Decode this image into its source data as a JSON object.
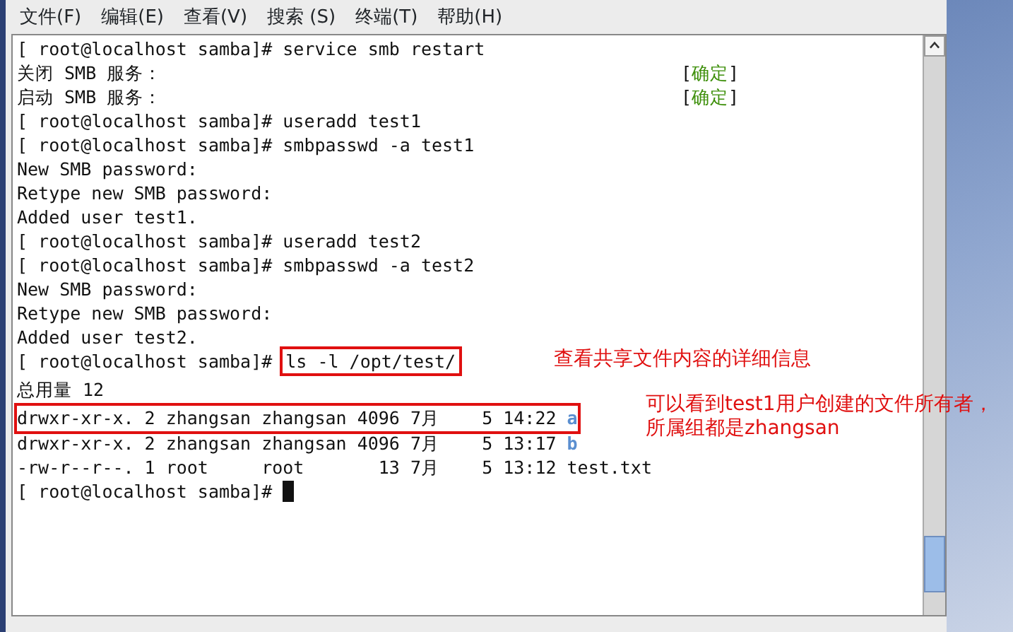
{
  "menu": [
    "文件(F)",
    "编辑(E)",
    "查看(V)",
    "搜索 (S)",
    "终端(T)",
    "帮助(H)"
  ],
  "terminal": {
    "lines": [
      {
        "segments": [
          {
            "text": "[ root@localhost samba]# service smb restart",
            "kind": "plain"
          }
        ]
      },
      {
        "segments": [
          {
            "text": "关闭 SMB 服务：",
            "kind": "plain"
          }
        ],
        "right": [
          {
            "text": "[",
            "kind": "plain"
          },
          {
            "text": "确定",
            "kind": "ok"
          },
          {
            "text": "]",
            "kind": "plain"
          }
        ]
      },
      {
        "segments": [
          {
            "text": "启动 SMB 服务：",
            "kind": "plain"
          }
        ],
        "right": [
          {
            "text": "[",
            "kind": "plain"
          },
          {
            "text": "确定",
            "kind": "ok"
          },
          {
            "text": "]",
            "kind": "plain"
          }
        ]
      },
      {
        "segments": [
          {
            "text": "[ root@localhost samba]# useradd test1",
            "kind": "plain"
          }
        ]
      },
      {
        "segments": [
          {
            "text": "[ root@localhost samba]# smbpasswd -a test1",
            "kind": "plain"
          }
        ]
      },
      {
        "segments": [
          {
            "text": "New SMB password:",
            "kind": "plain"
          }
        ]
      },
      {
        "segments": [
          {
            "text": "Retype new SMB password:",
            "kind": "plain"
          }
        ]
      },
      {
        "segments": [
          {
            "text": "Added user test1.",
            "kind": "plain"
          }
        ]
      },
      {
        "segments": [
          {
            "text": "[ root@localhost samba]# useradd test2",
            "kind": "plain"
          }
        ]
      },
      {
        "segments": [
          {
            "text": "[ root@localhost samba]# smbpasswd -a test2",
            "kind": "plain"
          }
        ]
      },
      {
        "segments": [
          {
            "text": "New SMB password:",
            "kind": "plain"
          }
        ]
      },
      {
        "segments": [
          {
            "text": "Retype new SMB password:",
            "kind": "plain"
          }
        ]
      },
      {
        "segments": [
          {
            "text": "Added user test2.",
            "kind": "plain"
          }
        ]
      },
      {
        "segments": [
          {
            "text": "[ root@localhost samba]# ",
            "kind": "plain"
          },
          {
            "text": "ls -l /opt/test/",
            "kind": "boxed"
          }
        ],
        "note": "查看共享文件内容的详细信息"
      },
      {
        "segments": [
          {
            "text": "总用量 12",
            "kind": "plain"
          }
        ]
      },
      {
        "boxed": true,
        "segments": [
          {
            "text": "drwxr-xr-x. 2 zhangsan zhangsan 4096 7月    5 14:22 ",
            "kind": "plain"
          },
          {
            "text": "a",
            "kind": "dir"
          }
        ],
        "note": "可以看到test1用户创建的文件所有者，所属组都是zhangsan"
      },
      {
        "segments": [
          {
            "text": "drwxr-xr-x. 2 zhangsan zhangsan 4096 7月    5 13:17 ",
            "kind": "plain"
          },
          {
            "text": "b",
            "kind": "dir"
          }
        ]
      },
      {
        "segments": [
          {
            "text": "-rw-r--r--. 1 root     root       13 7月    5 13:12 test.txt",
            "kind": "plain"
          }
        ]
      },
      {
        "segments": [
          {
            "text": "[ root@localhost samba]# ",
            "kind": "plain"
          }
        ],
        "cursor": true
      }
    ]
  }
}
